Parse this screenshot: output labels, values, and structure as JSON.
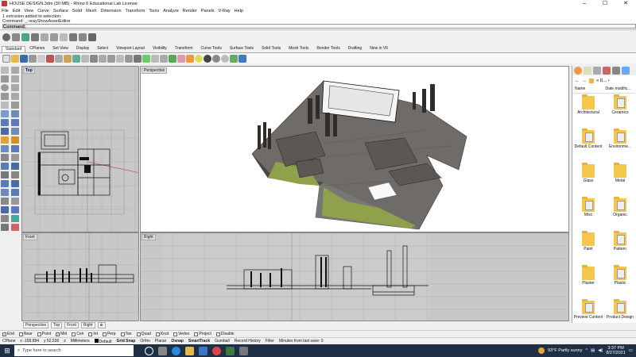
{
  "window": {
    "title": "HOUSE DESIGN.3dm (30 MB) - Rhino 6 Educational Lab License",
    "controls": [
      "–",
      "☐",
      "✕"
    ]
  },
  "menu": [
    "File",
    "Edit",
    "View",
    "Curve",
    "Surface",
    "Solid",
    "Mesh",
    "Dimension",
    "Transform",
    "Tools",
    "Analyze",
    "Render",
    "Panels",
    "V-Ray",
    "Help"
  ],
  "command": {
    "history1": "1 extrusion added to selection.",
    "history2": "Command: _-vrayShowAssetEditor",
    "prompt": "Command:"
  },
  "tabs": [
    "Standard",
    "CPlanes",
    "Set View",
    "Display",
    "Select",
    "Viewport Layout",
    "Visibility",
    "Transform",
    "Curve Tools",
    "Surface Tools",
    "Solid Tools",
    "Mesh Tools",
    "Render Tools",
    "Drafting",
    "New in V6"
  ],
  "active_tab": "Standard",
  "viewports": {
    "top": "Top",
    "perspective": "Perspective",
    "front": "Front",
    "right": "Right"
  },
  "viewport_tabs": [
    "Perspective",
    "Top",
    "Front",
    "Right",
    "⊕"
  ],
  "panel": {
    "path": "« lt... ›",
    "col_name": "Name",
    "col_date": "Date modific...",
    "folders": [
      {
        "name": "Architectural",
        "doc": false
      },
      {
        "name": "Ceramics",
        "doc": true
      },
      {
        "name": "Default Content",
        "doc": true
      },
      {
        "name": "Environme...",
        "doc": true
      },
      {
        "name": "Glass",
        "doc": false
      },
      {
        "name": "Metal",
        "doc": false
      },
      {
        "name": "Misc",
        "doc": true
      },
      {
        "name": "Organic",
        "doc": true
      },
      {
        "name": "Paint",
        "doc": false
      },
      {
        "name": "Pattern",
        "doc": true
      },
      {
        "name": "Plaster",
        "doc": false
      },
      {
        "name": "Plastic",
        "doc": true
      },
      {
        "name": "Preview Content",
        "doc": true
      },
      {
        "name": "Product Design",
        "doc": true
      }
    ]
  },
  "osnap": [
    {
      "label": "End",
      "checked": true
    },
    {
      "label": "Near",
      "checked": false
    },
    {
      "label": "Point",
      "checked": false
    },
    {
      "label": "Mid",
      "checked": true
    },
    {
      "label": "Cen",
      "checked": false
    },
    {
      "label": "Int",
      "checked": false
    },
    {
      "label": "Perp",
      "checked": false
    },
    {
      "label": "Tan",
      "checked": false
    },
    {
      "label": "Quad",
      "checked": false
    },
    {
      "label": "Knot",
      "checked": false
    },
    {
      "label": "Vertex",
      "checked": false
    },
    {
      "label": "Project",
      "checked": false
    },
    {
      "label": "Disable",
      "checked": false
    }
  ],
  "status": {
    "cplane": "CPlane",
    "x": "x -158.894",
    "y": "y 52.536",
    "z": "z",
    "units": "Millimeters",
    "layer": "Default",
    "toggles": [
      "Grid Snap",
      "Ortho",
      "Planar",
      "Osnap",
      "SmartTrack",
      "Gumball",
      "Record History",
      "Filter"
    ],
    "message": "Minutes from last save: 0"
  },
  "taskbar": {
    "search_placeholder": "Type here to search",
    "weather": "93°F  Partly sunny",
    "time": "3:37 PM",
    "date": "8/27/2021"
  }
}
